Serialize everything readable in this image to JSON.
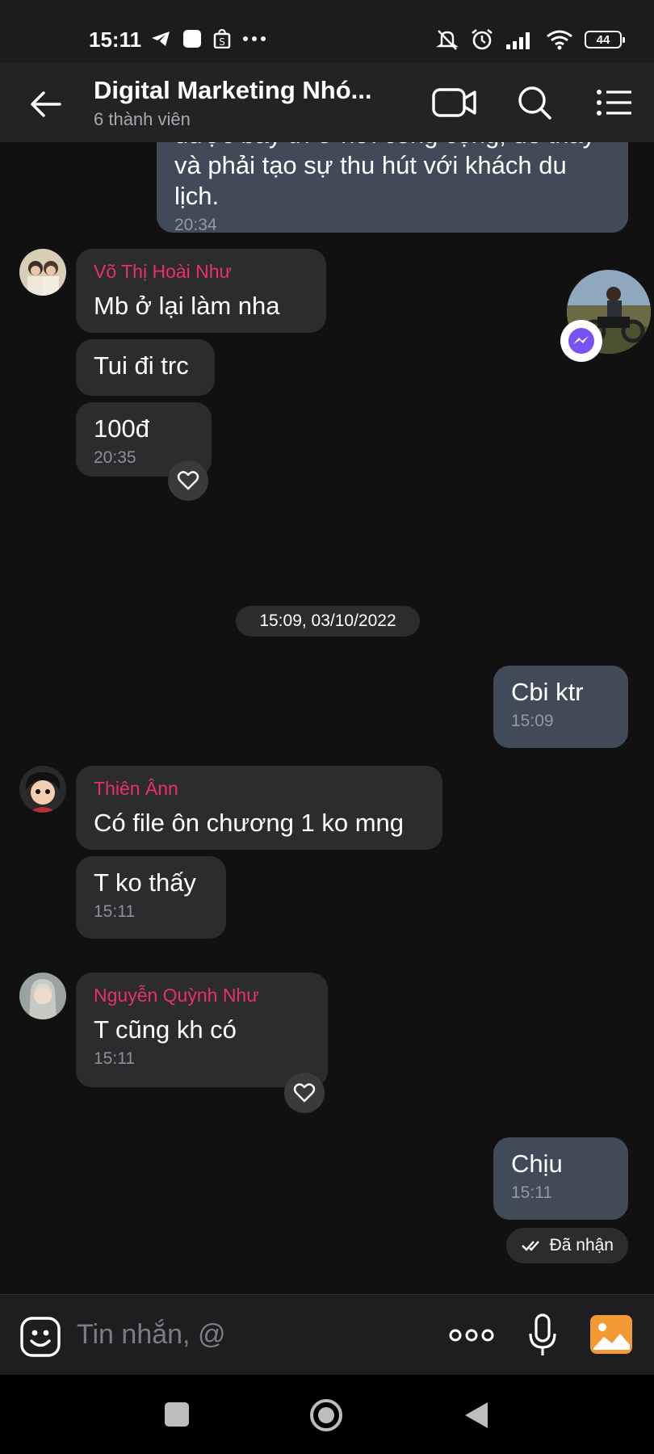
{
  "status_bar": {
    "time": "15:11",
    "battery": "44"
  },
  "header": {
    "title": "Digital Marketing Nhó...",
    "subtitle": "6 thành viên"
  },
  "messages": [
    {
      "id": "m0",
      "direction": "out",
      "text": "được bày trí ở nơi công cộng, dễ thấy và phải tạo sự thu hút với khách du lịch.",
      "time": "20:34"
    },
    {
      "id": "m1",
      "direction": "in",
      "sender": "Võ Thị Hoài Như",
      "text": "Mb ở lại làm nha"
    },
    {
      "id": "m2",
      "direction": "in",
      "text": "Tui đi trc"
    },
    {
      "id": "m3",
      "direction": "in",
      "text": "100đ",
      "time": "20:35"
    },
    {
      "id": "m4",
      "direction": "out",
      "text": "Cbi ktr",
      "time": "15:09"
    },
    {
      "id": "m5",
      "direction": "in",
      "sender": "Thiên Ânn",
      "text": "Có file ôn chương 1 ko mng"
    },
    {
      "id": "m6",
      "direction": "in",
      "text": "T ko thấy",
      "time": "15:11"
    },
    {
      "id": "m7",
      "direction": "in",
      "sender": "Nguyễn Quỳnh Như",
      "text": "T cũng kh có",
      "time": "15:11"
    },
    {
      "id": "m8",
      "direction": "out",
      "text": "Chịu",
      "time": "15:11"
    }
  ],
  "date_separator": "15:09, 03/10/2022",
  "receipt_status": "Đã nhận",
  "input": {
    "placeholder": "Tin nhắn, @"
  },
  "icons": {
    "back": "arrow-left-icon",
    "video": "video-call-icon",
    "search": "search-icon",
    "menu": "list-menu-icon",
    "sticker": "sticker-icon",
    "more": "more-dots-icon",
    "mic": "microphone-icon",
    "image": "image-icon",
    "heart": "heart-icon"
  },
  "colors": {
    "sender_name": "#e8316b",
    "outgoing_bubble": "#404a58",
    "incoming_bubble": "#2c2c2e",
    "image_button": "#f39a35"
  }
}
